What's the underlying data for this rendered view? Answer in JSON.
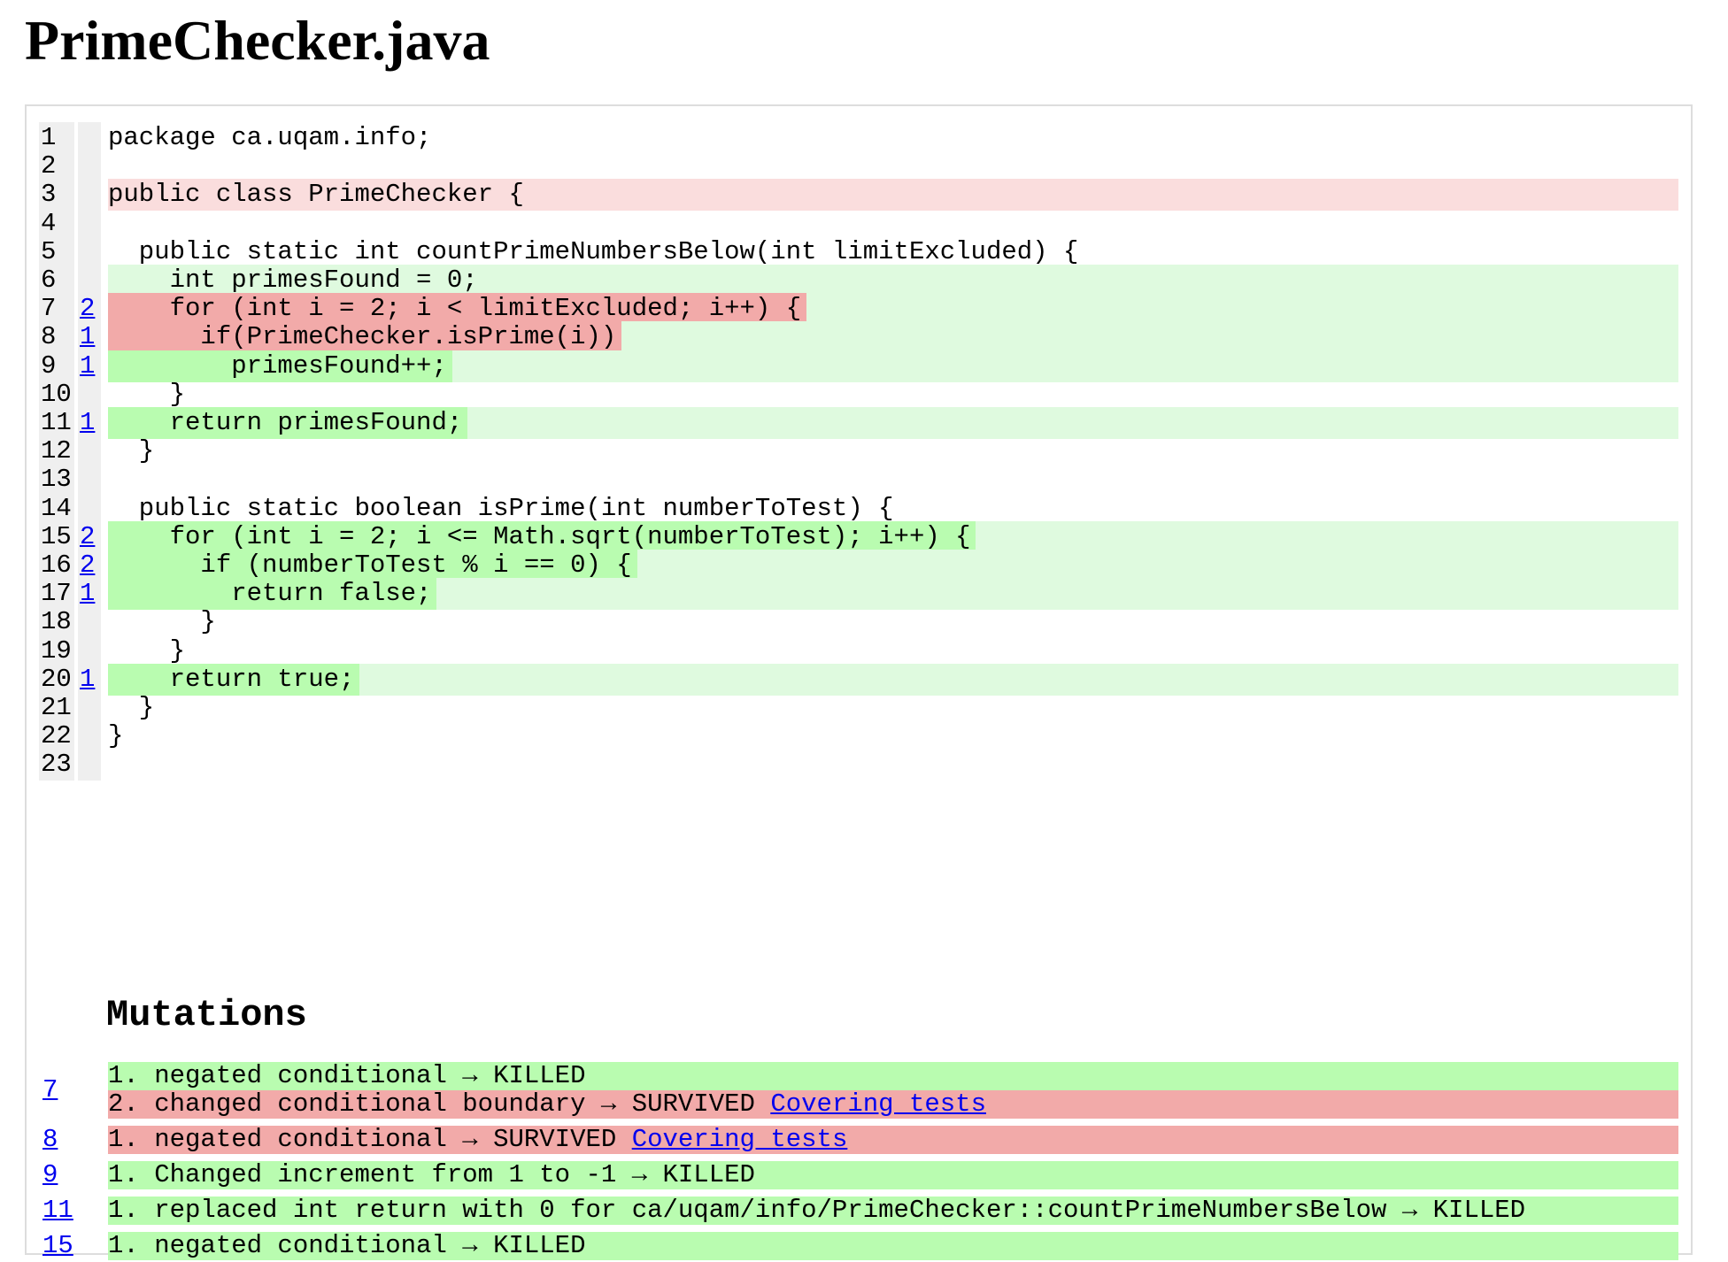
{
  "page_title": "PrimeChecker.java",
  "colors": {
    "covered_line_bg": "#dffadf",
    "uncovered_line_bg": "#fadddd",
    "killed_bg": "#b9fcb0",
    "survived_bg": "#f2aaa9",
    "link": "#0000ee"
  },
  "source_lines": [
    {
      "num": "1",
      "mutations": "",
      "code": "package ca.uqam.info;",
      "line_status": "none",
      "code_status": "none"
    },
    {
      "num": "2",
      "mutations": "",
      "code": "",
      "line_status": "none",
      "code_status": "none"
    },
    {
      "num": "3",
      "mutations": "",
      "code": "public class PrimeChecker {",
      "line_status": "uncovered",
      "code_status": "none"
    },
    {
      "num": "4",
      "mutations": "",
      "code": "",
      "line_status": "none",
      "code_status": "none"
    },
    {
      "num": "5",
      "mutations": "",
      "code": "  public static int countPrimeNumbersBelow(int limitExcluded) {",
      "line_status": "none",
      "code_status": "none"
    },
    {
      "num": "6",
      "mutations": "",
      "code": "    int primesFound = 0;",
      "line_status": "covered",
      "code_status": "none"
    },
    {
      "num": "7",
      "mutations": "2",
      "code": "    for (int i = 2; i < limitExcluded; i++) {",
      "line_status": "covered",
      "code_status": "survived"
    },
    {
      "num": "8",
      "mutations": "1",
      "code": "      if(PrimeChecker.isPrime(i))",
      "line_status": "covered",
      "code_status": "survived"
    },
    {
      "num": "9",
      "mutations": "1",
      "code": "        primesFound++;",
      "line_status": "covered",
      "code_status": "killed"
    },
    {
      "num": "10",
      "mutations": "",
      "code": "    }",
      "line_status": "none",
      "code_status": "none"
    },
    {
      "num": "11",
      "mutations": "1",
      "code": "    return primesFound;",
      "line_status": "covered",
      "code_status": "killed"
    },
    {
      "num": "12",
      "mutations": "",
      "code": "  }",
      "line_status": "none",
      "code_status": "none"
    },
    {
      "num": "13",
      "mutations": "",
      "code": "",
      "line_status": "none",
      "code_status": "none"
    },
    {
      "num": "14",
      "mutations": "",
      "code": "  public static boolean isPrime(int numberToTest) {",
      "line_status": "none",
      "code_status": "none"
    },
    {
      "num": "15",
      "mutations": "2",
      "code": "    for (int i = 2; i <= Math.sqrt(numberToTest); i++) {",
      "line_status": "covered",
      "code_status": "killed"
    },
    {
      "num": "16",
      "mutations": "2",
      "code": "      if (numberToTest % i == 0) {",
      "line_status": "covered",
      "code_status": "killed"
    },
    {
      "num": "17",
      "mutations": "1",
      "code": "        return false;",
      "line_status": "covered",
      "code_status": "killed"
    },
    {
      "num": "18",
      "mutations": "",
      "code": "      }",
      "line_status": "none",
      "code_status": "none"
    },
    {
      "num": "19",
      "mutations": "",
      "code": "    }",
      "line_status": "none",
      "code_status": "none"
    },
    {
      "num": "20",
      "mutations": "1",
      "code": "    return true;",
      "line_status": "covered",
      "code_status": "killed"
    },
    {
      "num": "21",
      "mutations": "",
      "code": "  }",
      "line_status": "none",
      "code_status": "none"
    },
    {
      "num": "22",
      "mutations": "",
      "code": "}",
      "line_status": "none",
      "code_status": "none"
    },
    {
      "num": "23",
      "mutations": "",
      "code": "",
      "line_status": "none",
      "code_status": "none"
    }
  ],
  "mutations_heading": "Mutations",
  "mutation_groups": [
    {
      "line": "7",
      "items": [
        {
          "text": "1. negated conditional → KILLED",
          "status": "killed",
          "link": ""
        },
        {
          "text": "2. changed conditional boundary → SURVIVED ",
          "status": "survived",
          "link": "Covering tests"
        }
      ]
    },
    {
      "line": "8",
      "items": [
        {
          "text": "1. negated conditional → SURVIVED ",
          "status": "survived",
          "link": "Covering tests"
        }
      ]
    },
    {
      "line": "9",
      "items": [
        {
          "text": "1. Changed increment from 1 to -1 → KILLED",
          "status": "killed",
          "link": ""
        }
      ]
    },
    {
      "line": "11",
      "items": [
        {
          "text": "1. replaced int return with 0 for ca/uqam/info/PrimeChecker::countPrimeNumbersBelow → KILLED",
          "status": "killed",
          "link": ""
        }
      ]
    },
    {
      "line": "15",
      "items": [
        {
          "text": "1. negated conditional → KILLED",
          "status": "killed",
          "link": ""
        }
      ]
    }
  ]
}
